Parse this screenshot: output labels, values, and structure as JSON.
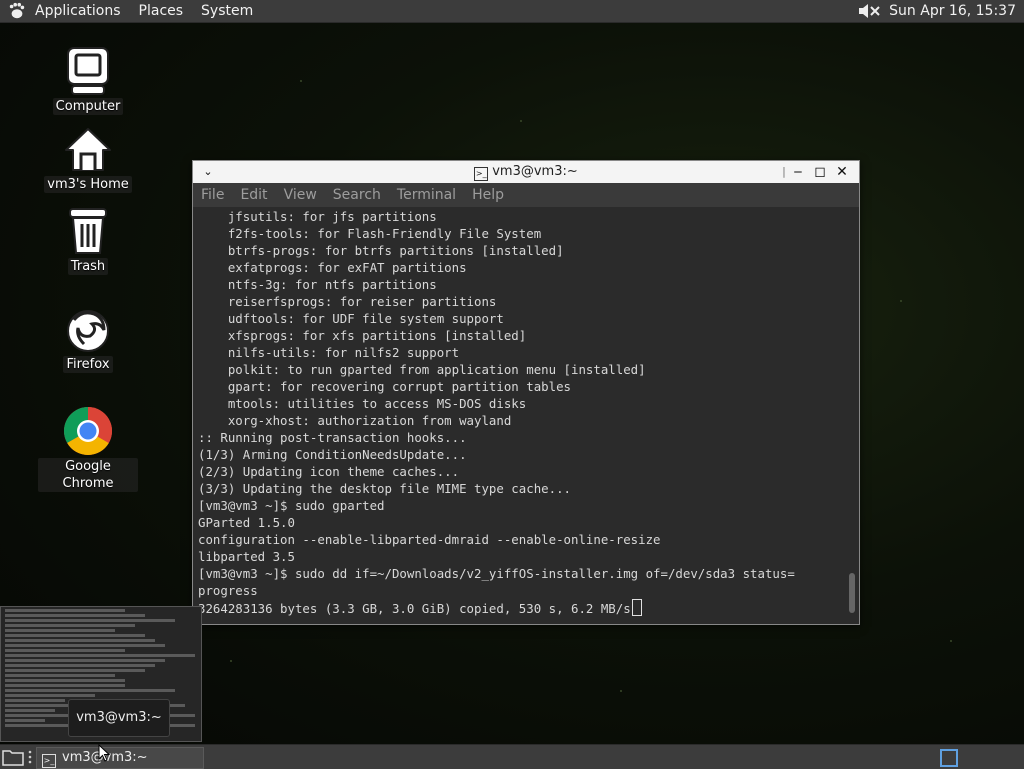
{
  "top_panel": {
    "menus": [
      "Applications",
      "Places",
      "System"
    ],
    "clock": "Sun Apr 16, 15:37"
  },
  "desktop_icons": [
    {
      "label": "Computer",
      "icon": "computer-icon"
    },
    {
      "label": "vm3's Home",
      "icon": "home-icon"
    },
    {
      "label": "Trash",
      "icon": "trash-icon"
    },
    {
      "label": "Firefox",
      "icon": "firefox-icon"
    },
    {
      "label": "Google Chrome",
      "icon": "chrome-icon"
    }
  ],
  "terminal": {
    "title": "vm3@vm3:~",
    "menu": [
      "File",
      "Edit",
      "View",
      "Search",
      "Terminal",
      "Help"
    ],
    "lines": [
      "    jfsutils: for jfs partitions",
      "    f2fs-tools: for Flash-Friendly File System",
      "    btrfs-progs: for btrfs partitions [installed]",
      "    exfatprogs: for exFAT partitions",
      "    ntfs-3g: for ntfs partitions",
      "    reiserfsprogs: for reiser partitions",
      "    udftools: for UDF file system support",
      "    xfsprogs: for xfs partitions [installed]",
      "    nilfs-utils: for nilfs2 support",
      "    polkit: to run gparted from application menu [installed]",
      "    gpart: for recovering corrupt partition tables",
      "    mtools: utilities to access MS-DOS disks",
      "    xorg-xhost: authorization from wayland",
      ":: Running post-transaction hooks...",
      "(1/3) Arming ConditionNeedsUpdate...",
      "(2/3) Updating icon theme caches...",
      "(3/3) Updating the desktop file MIME type cache...",
      "[vm3@vm3 ~]$ sudo gparted",
      "GParted 1.5.0",
      "configuration --enable-libparted-dmraid --enable-online-resize",
      "libparted 3.5",
      "[vm3@vm3 ~]$ sudo dd if=~/Downloads/v2_yiffOS-installer.img of=/dev/sda3 status=",
      "progress",
      "3264283136 bytes (3.3 GB, 3.0 GiB) copied, 530 s, 6.2 MB/s"
    ]
  },
  "tooltip": "vm3@vm3:~",
  "taskbar": {
    "task_label": "vm3@vm3:~"
  }
}
